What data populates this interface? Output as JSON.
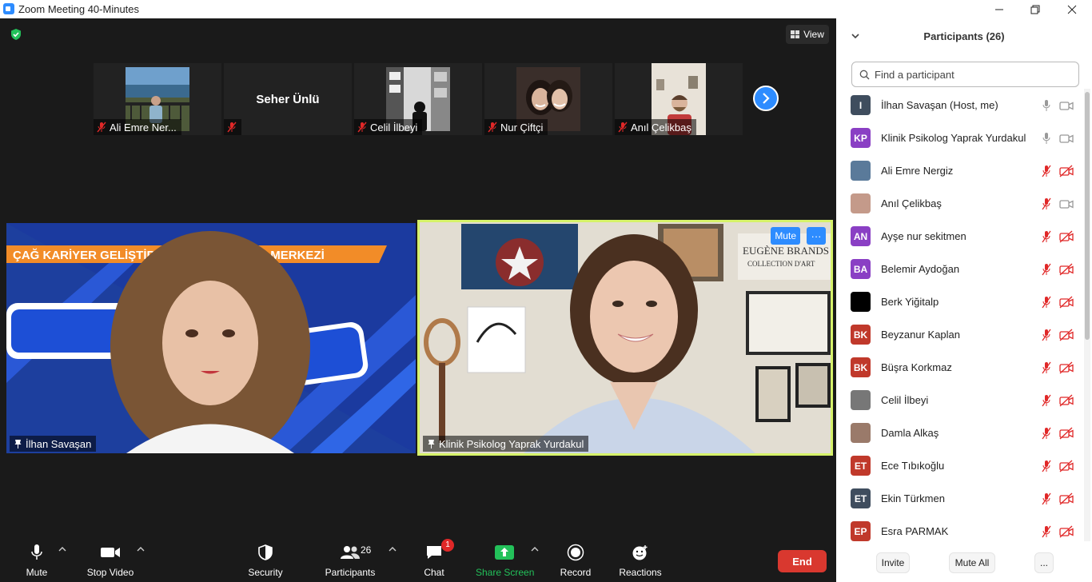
{
  "window": {
    "title": "Zoom Meeting 40-Minutes"
  },
  "meeting": {
    "view_label": "View",
    "strip": [
      {
        "name": "Ali Emre Ner...",
        "has_video": true
      },
      {
        "name": "Seher Ünlü",
        "has_video": false,
        "center_name": "Seher Ünlü"
      },
      {
        "name": "Celil İlbeyi",
        "has_video": true
      },
      {
        "name": "Nur Çiftçi",
        "has_video": true
      },
      {
        "name": "Anıl Çelikbaş",
        "has_video": true
      }
    ],
    "main_tiles": [
      {
        "name": "İlhan Savaşan",
        "banner_text": "ÇAĞ KARİYER GELİŞTİRME VE ARAŞTIRMA MERKEZİ"
      },
      {
        "name": "Klinik Psikolog Yaprak Yurdakul",
        "mute_label": "Mute",
        "more_label": "···",
        "sign_text": "EUGÈNE BRANDS",
        "sign_sub": "COLLECTION D'ART"
      }
    ]
  },
  "toolbar": {
    "mute": "Mute",
    "stop_video": "Stop Video",
    "security": "Security",
    "participants": "Participants",
    "participants_count": "26",
    "chat": "Chat",
    "chat_badge": "1",
    "share_screen": "Share Screen",
    "record": "Record",
    "reactions": "Reactions",
    "end": "End"
  },
  "colors": {
    "accent": "#2d8cff",
    "share_green": "#23c15a",
    "end_red": "#d9382f",
    "muted_red": "#e02828",
    "active_speaker": "#d6f26a"
  },
  "panel": {
    "title": "Participants (26)",
    "search_placeholder": "Find a participant",
    "participants": [
      {
        "initials": "I",
        "name": "İlhan Savaşan (Host, me)",
        "color": "#3f4d5e",
        "mic": "on",
        "cam": "on"
      },
      {
        "initials": "KP",
        "name": "Klinik Psikolog Yaprak Yurdakul",
        "color": "#8a3fc4",
        "mic": "on",
        "cam": "on"
      },
      {
        "initials": "",
        "name": "Ali Emre Nergiz",
        "color": "#5a7a9a",
        "mic": "off",
        "cam": "off"
      },
      {
        "initials": "",
        "name": "Anıl Çelikbaş",
        "color": "#c49a8a",
        "mic": "off",
        "cam": "on"
      },
      {
        "initials": "AN",
        "name": "Ayşe nur sekitmen",
        "color": "#8a3fc4",
        "mic": "off",
        "cam": "off"
      },
      {
        "initials": "BA",
        "name": "Belemir Aydoğan",
        "color": "#8a3fc4",
        "mic": "off",
        "cam": "off"
      },
      {
        "initials": "",
        "name": "Berk Yiğitalp",
        "color": "#000000",
        "mic": "off",
        "cam": "off"
      },
      {
        "initials": "BK",
        "name": "Beyzanur Kaplan",
        "color": "#c0392b",
        "mic": "off",
        "cam": "off"
      },
      {
        "initials": "BK",
        "name": "Büşra Korkmaz",
        "color": "#c0392b",
        "mic": "off",
        "cam": "off"
      },
      {
        "initials": "",
        "name": "Celil İlbeyi",
        "color": "#777777",
        "mic": "off",
        "cam": "off"
      },
      {
        "initials": "",
        "name": "Damla Alkaş",
        "color": "#9a7a6a",
        "mic": "off",
        "cam": "off"
      },
      {
        "initials": "ET",
        "name": "Ece Tıbıkoğlu",
        "color": "#c0392b",
        "mic": "off",
        "cam": "off"
      },
      {
        "initials": "ET",
        "name": "Ekin Türkmen",
        "color": "#3f4d5e",
        "mic": "off",
        "cam": "off"
      },
      {
        "initials": "EP",
        "name": "Esra PARMAK",
        "color": "#c0392b",
        "mic": "off",
        "cam": "off"
      }
    ],
    "invite": "Invite",
    "mute_all": "Mute All",
    "more": "..."
  }
}
